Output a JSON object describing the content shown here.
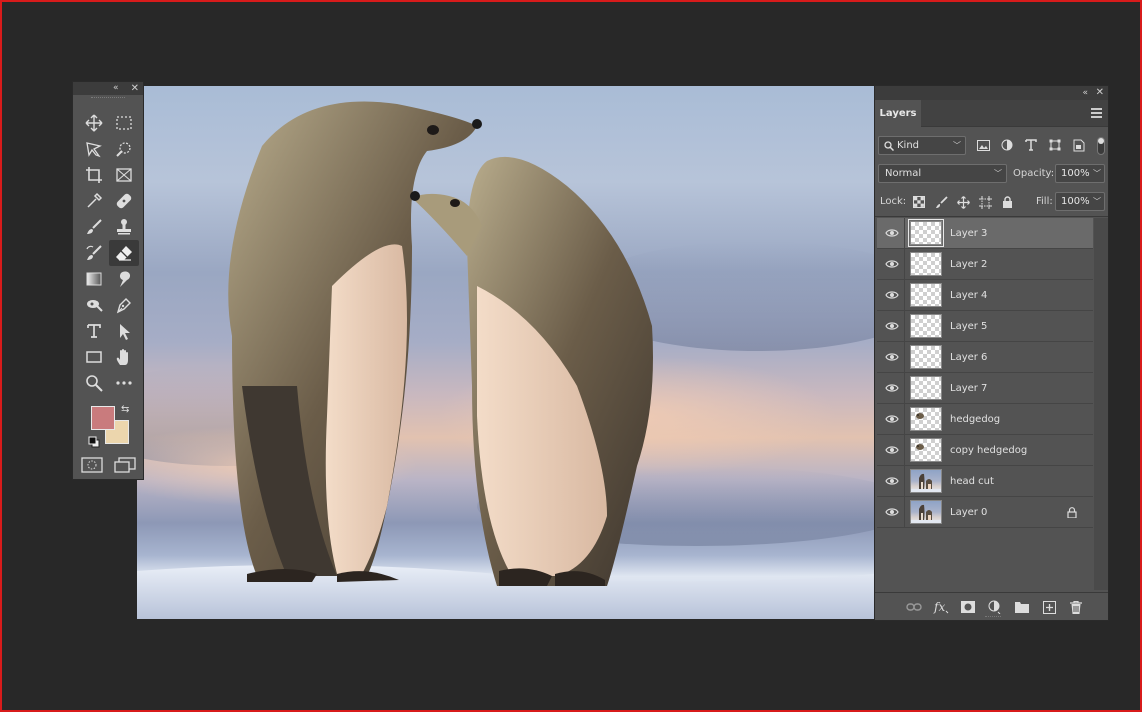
{
  "toolbox": {
    "tools": [
      {
        "name": "move-tool-icon",
        "active": false
      },
      {
        "name": "marquee-tool-icon",
        "active": false
      },
      {
        "name": "lasso-tool-icon",
        "active": false
      },
      {
        "name": "quick-selection-tool-icon",
        "active": false
      },
      {
        "name": "crop-tool-icon",
        "active": false
      },
      {
        "name": "frame-tool-icon",
        "active": false
      },
      {
        "name": "eyedropper-tool-icon",
        "active": false
      },
      {
        "name": "healing-brush-tool-icon",
        "active": false
      },
      {
        "name": "brush-tool-icon",
        "active": false
      },
      {
        "name": "clone-stamp-tool-icon",
        "active": false
      },
      {
        "name": "history-brush-tool-icon",
        "active": false
      },
      {
        "name": "eraser-tool-icon",
        "active": true
      },
      {
        "name": "gradient-tool-icon",
        "active": false
      },
      {
        "name": "smudge-tool-icon",
        "active": false
      },
      {
        "name": "dodge-tool-icon",
        "active": false
      },
      {
        "name": "pen-tool-icon",
        "active": false
      },
      {
        "name": "type-tool-icon",
        "active": false
      },
      {
        "name": "path-selection-tool-icon",
        "active": false
      },
      {
        "name": "rectangle-tool-icon",
        "active": false
      },
      {
        "name": "hand-tool-icon",
        "active": false
      },
      {
        "name": "zoom-tool-icon",
        "active": false
      },
      {
        "name": "more-tools-icon",
        "active": false
      }
    ],
    "foreground_color": "#c97b7d",
    "background_color": "#ecd6ad"
  },
  "layers_panel": {
    "tab_label": "Layers",
    "filter_kind": "Kind",
    "blend_mode": "Normal",
    "opacity_label": "Opacity:",
    "opacity_value": "100%",
    "lock_label": "Lock:",
    "fill_label": "Fill:",
    "fill_value": "100%",
    "layers": [
      {
        "name": "Layer 3",
        "selected": true,
        "thumb": "transparent",
        "locked": false
      },
      {
        "name": "Layer 2",
        "selected": false,
        "thumb": "transparent",
        "locked": false
      },
      {
        "name": "Layer 4",
        "selected": false,
        "thumb": "transparent",
        "locked": false
      },
      {
        "name": "Layer 5",
        "selected": false,
        "thumb": "transparent",
        "locked": false
      },
      {
        "name": "Layer 6",
        "selected": false,
        "thumb": "transparent",
        "locked": false
      },
      {
        "name": "Layer 7",
        "selected": false,
        "thumb": "transparent",
        "locked": false
      },
      {
        "name": "hedgedog",
        "selected": false,
        "thumb": "hedgehog",
        "locked": false
      },
      {
        "name": "copy hedgedog",
        "selected": false,
        "thumb": "hedgehog",
        "locked": false
      },
      {
        "name": "head cut",
        "selected": false,
        "thumb": "photo",
        "locked": false
      },
      {
        "name": "Layer 0",
        "selected": false,
        "thumb": "photo",
        "locked": true
      }
    ],
    "footer_icons": [
      "link-layers-icon",
      "fx-icon",
      "layer-mask-icon",
      "adjustment-layer-icon",
      "group-folder-icon",
      "new-layer-icon",
      "trash-icon"
    ]
  }
}
